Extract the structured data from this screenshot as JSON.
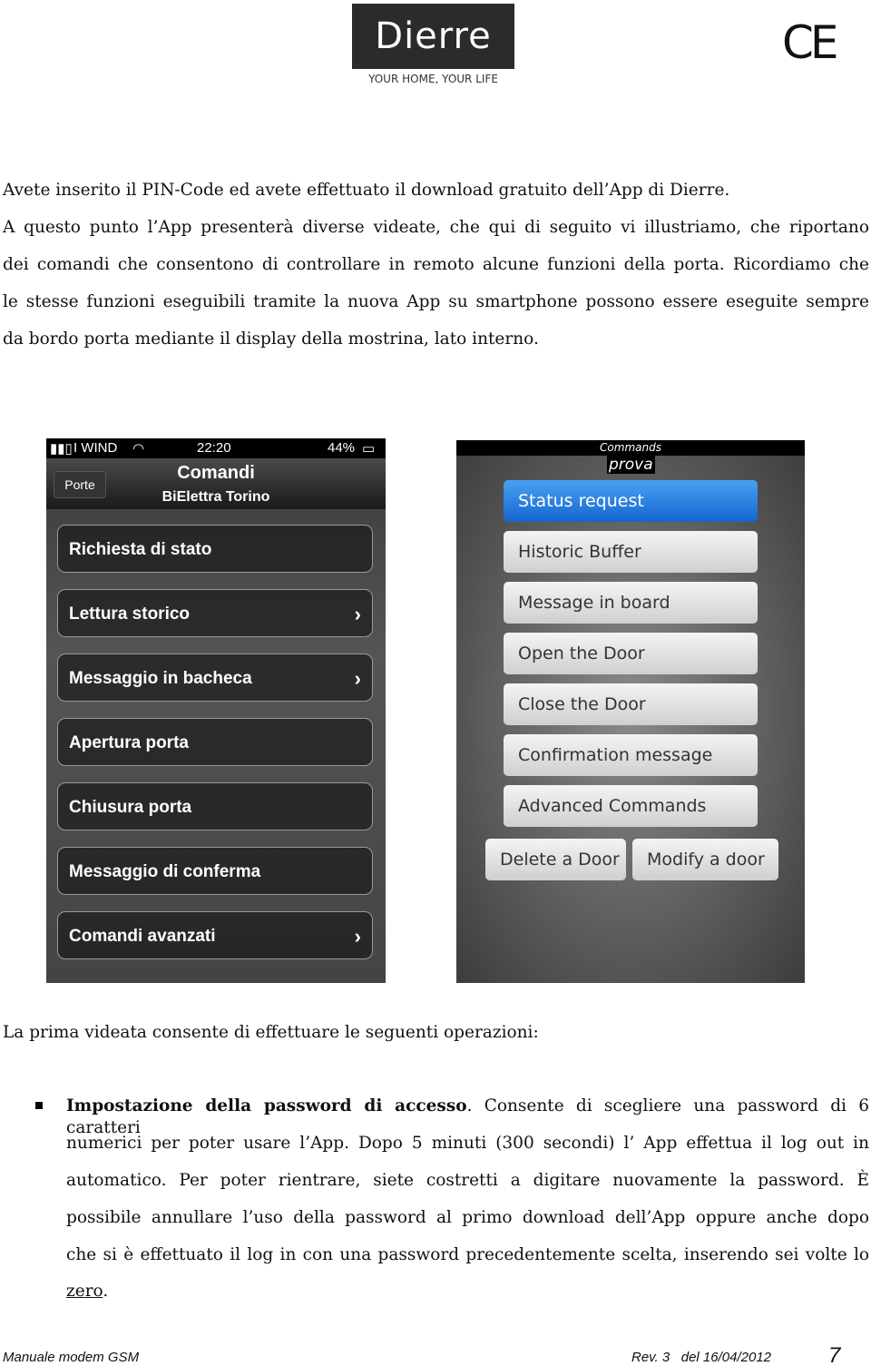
{
  "header": {
    "logo": "Dierre",
    "tagline": "YOUR HOME, YOUR LIFE",
    "ce_mark": "CE"
  },
  "intro_lines": [
    "Avete inserito il PIN-Code ed avete effettuato il download gratuito dell’App di Dierre.",
    "A questo punto l’App presenterà diverse videate, che qui di seguito vi illustriamo, che riportano",
    "dei comandi che consentono di controllare in remoto alcune funzioni della porta. Ricordiamo che",
    "le stesse funzioni eseguibili tramite la nuova App su smartphone possono essere eseguite sempre",
    "da bordo porta mediante il display della mostrina, lato interno."
  ],
  "phone1": {
    "carrier": "I WIND",
    "time": "22:20",
    "battery": "44%",
    "back": "Porte",
    "title": "Comandi",
    "subtitle": "BiElettra Torino",
    "items": [
      {
        "label": "Richiesta di stato",
        "chevron": false
      },
      {
        "label": "Lettura storico",
        "chevron": true
      },
      {
        "label": "Messaggio in bacheca",
        "chevron": true
      },
      {
        "label": "Apertura porta",
        "chevron": false
      },
      {
        "label": "Chiusura porta",
        "chevron": false
      },
      {
        "label": "Messaggio di conferma",
        "chevron": false
      },
      {
        "label": "Comandi avanzati",
        "chevron": true
      }
    ]
  },
  "phone2": {
    "header": "Commands",
    "name": "prova",
    "buttons": [
      "Status request",
      "Historic Buffer",
      "Message in board",
      "Open the Door",
      "Close the Door",
      "Confirmation message",
      "Advanced Commands"
    ],
    "bottom": [
      "Delete a Door",
      "Modify a door"
    ],
    "selected_color": "#1a6fd8"
  },
  "section_intro": "La prima videata consente di effettuare le seguenti operazioni:",
  "bullet": {
    "bold": "Impostazione della password di accesso",
    "lines": [
      ". Consente di scegliere una password di 6 caratteri",
      "numerici per poter usare l’App. Dopo 5 minuti (300 secondi) l’ App effettua il log out in",
      "automatico. Per poter rientrare, siete costretti a digitare nuovamente la password. È",
      "possibile annullare l’uso della password al primo download dell’App oppure anche dopo",
      "che si è effettuato il log in con una password precedentemente scelta, inserendo sei volte lo"
    ],
    "last": "zero",
    "last_suffix": "."
  },
  "footer": {
    "left": "Manuale modem GSM",
    "rev": "Rev. 3   del 16/04/2012",
    "page": "7"
  }
}
